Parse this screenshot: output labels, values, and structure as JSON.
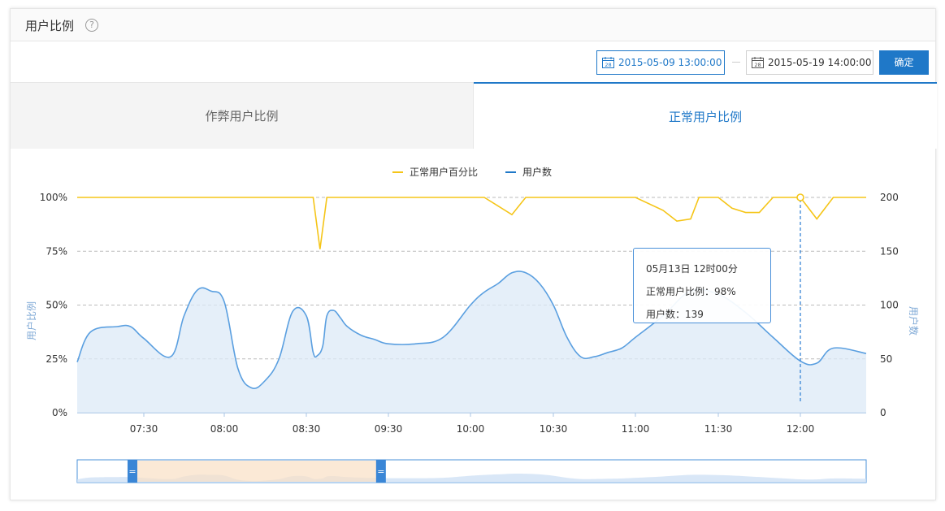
{
  "header": {
    "title": "用户比例",
    "help_icon": "help-circle-icon"
  },
  "datebar": {
    "start": "2015-05-09 13:00:00",
    "end": "2015-05-19 14:00:00",
    "confirm": "确定",
    "calendar_icon_day": "28"
  },
  "tabs": [
    {
      "label": "作弊用户比例",
      "active": false
    },
    {
      "label": "正常用户比例",
      "active": true
    }
  ],
  "tooltip": {
    "title": "05月13日 12时00分",
    "line1": "正常用户比例：98%",
    "line2": "用户数：139"
  },
  "colors": {
    "accent": "#1f78c8",
    "percent_line": "#f5c518",
    "users_line": "#5a9fe0",
    "users_fill": "#dce9f7",
    "zoom_window": "#f9e0c4"
  },
  "chart_data": {
    "type": "line",
    "title": "",
    "legend_position": "top-center",
    "x_ticks": [
      "07:30",
      "08:00",
      "08:30",
      "09:30",
      "10:00",
      "10:30",
      "11:00",
      "11:30",
      "12:00"
    ],
    "y_left": {
      "label": "用户比例",
      "ticks": [
        "0%",
        "25%",
        "50%",
        "75%",
        "100%"
      ],
      "range": [
        0,
        100
      ]
    },
    "y_right": {
      "label": "用户数",
      "ticks": [
        "0",
        "50",
        "100",
        "150",
        "200"
      ],
      "range": [
        0,
        200
      ]
    },
    "grid": "dashed-horizontal",
    "series": [
      {
        "name": "正常用户百分比",
        "axis": "left",
        "x": [
          "07:05",
          "07:30",
          "07:55",
          "08:00",
          "08:30",
          "08:35",
          "08:40",
          "08:45",
          "09:30",
          "09:40",
          "09:45",
          "10:00",
          "10:05",
          "10:10",
          "10:15",
          "10:20",
          "10:30",
          "10:55",
          "11:00",
          "11:10",
          "11:15",
          "11:20",
          "11:23",
          "11:27",
          "11:30",
          "11:35",
          "11:40",
          "11:45",
          "11:50",
          "11:55",
          "12:00",
          "12:05",
          "12:10",
          "12:20"
        ],
        "values": [
          100,
          100,
          100,
          100,
          100,
          100,
          76,
          100,
          100,
          100,
          100,
          100,
          100,
          96,
          92,
          100,
          100,
          100,
          100,
          94,
          89,
          90,
          100,
          100,
          100,
          95,
          93,
          93,
          100,
          100,
          100,
          90,
          100,
          100
        ]
      },
      {
        "name": "用户数",
        "axis": "right",
        "smooth": true,
        "x": [
          "07:05",
          "07:10",
          "07:20",
          "07:25",
          "07:30",
          "07:40",
          "07:45",
          "07:50",
          "07:55",
          "08:00",
          "08:05",
          "08:10",
          "08:15",
          "08:20",
          "08:25",
          "08:30",
          "08:35",
          "08:38",
          "08:42",
          "08:45",
          "08:50",
          "08:55",
          "09:00",
          "09:10",
          "09:20",
          "09:30",
          "09:40",
          "09:50",
          "10:00",
          "10:05",
          "10:10",
          "10:15",
          "10:20",
          "10:25",
          "10:30",
          "10:35",
          "10:40",
          "10:45",
          "10:50",
          "10:55",
          "11:00",
          "11:10",
          "11:20",
          "11:30",
          "11:40",
          "11:50",
          "12:00",
          "12:05",
          "12:10",
          "12:20"
        ],
        "values": [
          47,
          75,
          80,
          80,
          69,
          52,
          90,
          114,
          113,
          103,
          41,
          23,
          30,
          50,
          94,
          90,
          56,
          53,
          62,
          90,
          95,
          88,
          80,
          72,
          68,
          64,
          64,
          70,
          100,
          112,
          120,
          130,
          130,
          120,
          100,
          70,
          52,
          52,
          56,
          60,
          70,
          90,
          113,
          110,
          93,
          70,
          48,
          46,
          60,
          55
        ]
      }
    ]
  },
  "zoom": {
    "handle_glyph": "=",
    "start_fraction": 0.07,
    "end_fraction": 0.385
  }
}
